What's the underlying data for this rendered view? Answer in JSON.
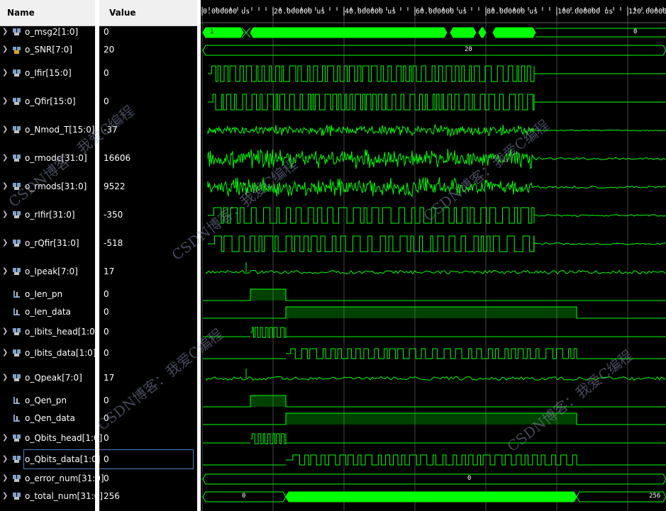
{
  "header": {
    "name_label": "Name",
    "value_label": "Value"
  },
  "timeline": [
    "0.000000 us",
    "20.000000 us",
    "40.000000 us",
    "60.000000 us",
    "80.000000 us",
    "100.000000 us",
    "120.000000"
  ],
  "signals": [
    {
      "name": "o_msg2[1:0]",
      "value": "0",
      "kind": "bus"
    },
    {
      "name": "o_SNR[7:0]",
      "value": "20",
      "kind": "bus-orange"
    },
    {
      "name": "o_Ifir[15:0]",
      "value": "0",
      "kind": "bus"
    },
    {
      "name": "o_Qfir[15:0]",
      "value": "0",
      "kind": "bus"
    },
    {
      "name": "o_Nmod_T[15:0]",
      "value": "-37",
      "kind": "bus"
    },
    {
      "name": "o_rmodc[31:0]",
      "value": "16606",
      "kind": "bus"
    },
    {
      "name": "o_rmods[31:0]",
      "value": "9522",
      "kind": "bus"
    },
    {
      "name": "o_rIfir[31:0]",
      "value": "-350",
      "kind": "bus"
    },
    {
      "name": "o_rQfir[31:0]",
      "value": "-518",
      "kind": "bus"
    },
    {
      "name": "o_Ipeak[7:0]",
      "value": "17",
      "kind": "bus"
    },
    {
      "name": "o_Ien_pn",
      "value": "0",
      "kind": "bit"
    },
    {
      "name": "o_Ien_data",
      "value": "0",
      "kind": "bit"
    },
    {
      "name": "o_Ibits_head[1:0]",
      "value": "0",
      "kind": "bus"
    },
    {
      "name": "o_Ibits_data[1:0]",
      "value": "0",
      "kind": "bus"
    },
    {
      "name": "o_Qpeak[7:0]",
      "value": "17",
      "kind": "bus"
    },
    {
      "name": "o_Qen_pn",
      "value": "0",
      "kind": "bit"
    },
    {
      "name": "o_Qen_data",
      "value": "0",
      "kind": "bit"
    },
    {
      "name": "o_Qbits_head[1:0]",
      "value": "0",
      "kind": "bus"
    },
    {
      "name": "o_Qbits_data[1:0]",
      "value": "0",
      "kind": "bus",
      "selected": true
    },
    {
      "name": "o_error_num[31:0]",
      "value": "0",
      "kind": "bus"
    },
    {
      "name": "o_total_num[31:0]",
      "value": "256",
      "kind": "bus"
    }
  ],
  "bus_values": {
    "msg2_start": "1",
    "msg2_end": "0",
    "snr": "20",
    "error_num": "0",
    "total_start": "0",
    "total_end": "256"
  },
  "watermarks": [
    "CSDN博客：我爱C编程",
    "CSDN博客：我爱C编程",
    "CSDN博客：我爱C编程",
    "CSDN博客：我爱C编程",
    "CSDN博客：我爱C编程"
  ],
  "colors": {
    "wave": "#00ff00",
    "grid": "#2a2a2a",
    "selection": "#4a7fc0"
  }
}
